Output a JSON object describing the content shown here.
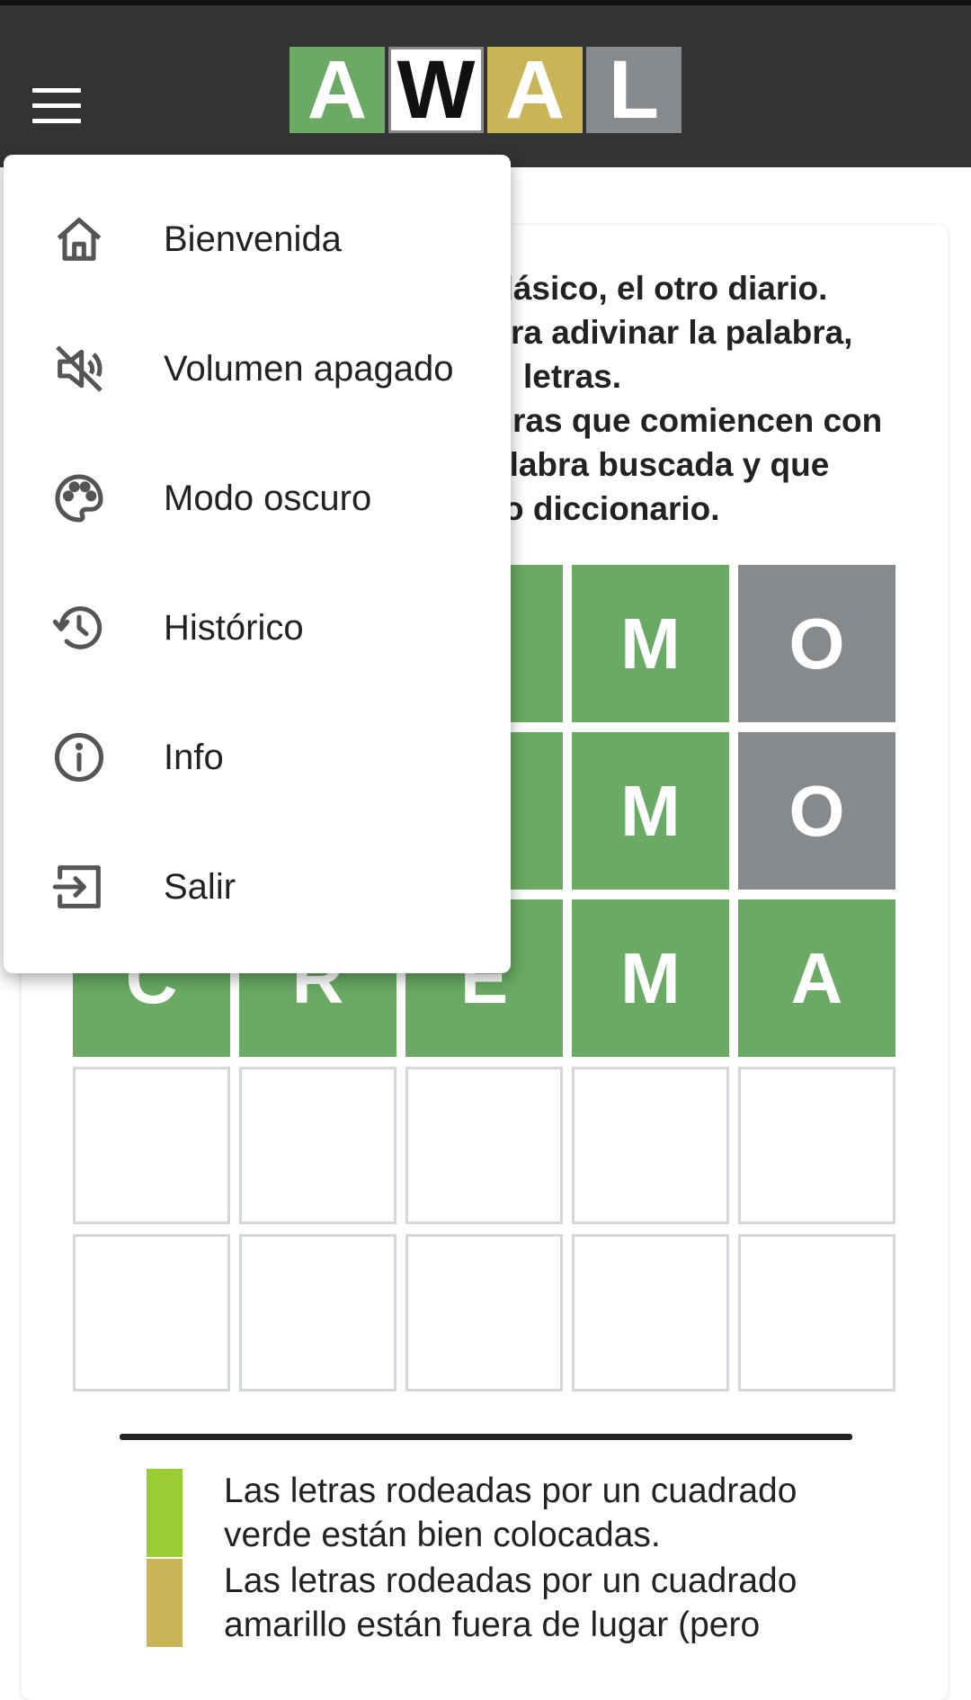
{
  "header": {
    "logo_letters": [
      "A",
      "W",
      "A",
      "L"
    ],
    "logo_colors": [
      "#6aaa64",
      "#ffffff",
      "#c9b458",
      "#878a8c"
    ]
  },
  "menu": {
    "items": [
      {
        "label": "Bienvenida",
        "icon": "home-icon"
      },
      {
        "label": "Volumen apagado",
        "icon": "volume-off-icon"
      },
      {
        "label": "Modo oscuro",
        "icon": "palette-icon"
      },
      {
        "label": "Histórico",
        "icon": "history-icon"
      },
      {
        "label": "Info",
        "icon": "info-icon"
      },
      {
        "label": "Salir",
        "icon": "logout-icon"
      }
    ]
  },
  "intro": {
    "lines": [
      "clásico, el otro diario.",
      "ra adivinar la palabra,",
      "letras.",
      "ras que comiencen con",
      "alabra buscada y que",
      "o diccionario."
    ]
  },
  "board": {
    "rows": [
      [
        {
          "letter": "",
          "state": "correct"
        },
        {
          "letter": "",
          "state": "correct"
        },
        {
          "letter": "",
          "state": "correct"
        },
        {
          "letter": "M",
          "state": "correct"
        },
        {
          "letter": "O",
          "state": "absent"
        }
      ],
      [
        {
          "letter": "",
          "state": "correct"
        },
        {
          "letter": "",
          "state": "correct"
        },
        {
          "letter": "",
          "state": "correct"
        },
        {
          "letter": "M",
          "state": "correct"
        },
        {
          "letter": "O",
          "state": "absent"
        }
      ],
      [
        {
          "letter": "C",
          "state": "correct"
        },
        {
          "letter": "R",
          "state": "correct"
        },
        {
          "letter": "E",
          "state": "correct"
        },
        {
          "letter": "M",
          "state": "correct"
        },
        {
          "letter": "A",
          "state": "correct"
        }
      ],
      [
        {
          "letter": "",
          "state": "empty"
        },
        {
          "letter": "",
          "state": "empty"
        },
        {
          "letter": "",
          "state": "empty"
        },
        {
          "letter": "",
          "state": "empty"
        },
        {
          "letter": "",
          "state": "empty"
        }
      ],
      [
        {
          "letter": "",
          "state": "empty"
        },
        {
          "letter": "",
          "state": "empty"
        },
        {
          "letter": "",
          "state": "empty"
        },
        {
          "letter": "",
          "state": "empty"
        },
        {
          "letter": "",
          "state": "empty"
        }
      ]
    ]
  },
  "legend": {
    "items": [
      {
        "color": "#9acd32",
        "text": [
          "Las letras rodeadas por un cuadrado",
          "verde están bien colocadas."
        ]
      },
      {
        "color": "#c9b458",
        "text": [
          "Las letras rodeadas por un cuadrado",
          "amarillo están fuera de lugar (pero"
        ]
      }
    ]
  }
}
